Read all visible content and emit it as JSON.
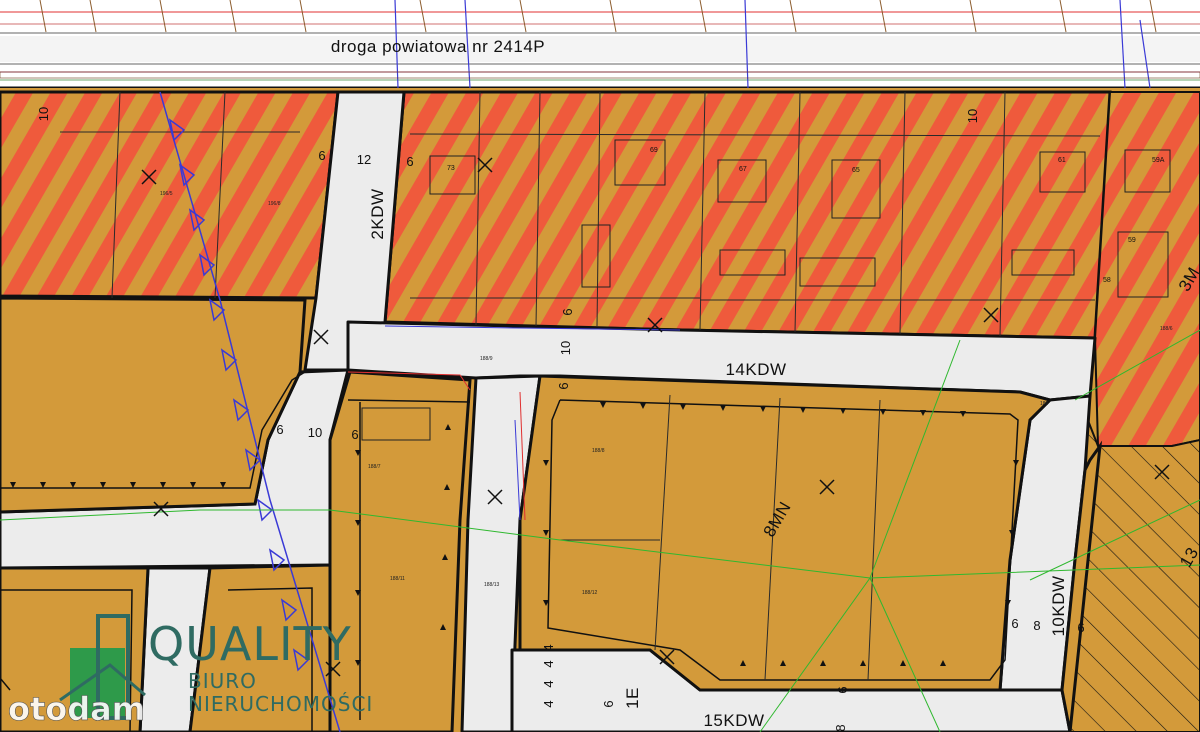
{
  "road": {
    "title": "droga powiatowa nr 2414P"
  },
  "zones": {
    "kdw_2": "2KDW",
    "kdw_14": "14KDW",
    "kdw_10": "10KDW",
    "kdw_15": "15KDW",
    "mn_8": "8MN",
    "edge_1e": "1E",
    "edge_3m": "3M",
    "edge_13": "13"
  },
  "dimensions": {
    "d10_left": "10",
    "d12": "12",
    "d6_a": "6",
    "d6_b": "6",
    "d10_top_right": "10",
    "d6_mid": "6",
    "d10_mid": "10",
    "d6_c": "6",
    "d6_left_road": "6",
    "d10_left_road": "10",
    "d6_left_road_b": "6",
    "d6_right_a": "6",
    "d8_right": "8",
    "d6_right_b": "6",
    "d4_a": "4",
    "d4_b": "4",
    "d4_c": "4",
    "d4_d": "4",
    "d6_bottom": "6",
    "d8_bottom": "8",
    "d6_small": "6"
  },
  "parcels": {
    "p73": "73",
    "p69": "69",
    "p67": "67",
    "p65": "65",
    "p61": "61",
    "p59a": "59A",
    "p59": "59",
    "p58": "58",
    "p188_6": "188/6",
    "p188_7": "188/7",
    "p188_8": "188/8",
    "p188_9": "188/9",
    "p188_11": "188/11",
    "p188_12": "188/12",
    "p188_13": "188/13",
    "p196_8": "196/8",
    "p196_5": "196/5",
    "p186": "186"
  },
  "logo": {
    "brand": "QUALITY",
    "line1": "BIURO",
    "line2": "NIERUCHOMOŚCI"
  },
  "watermark": {
    "text": "otodam"
  },
  "colors": {
    "zone_fill": "#d39a3a",
    "stripe_red": "#ef5a3c",
    "road_fill": "#ececec",
    "boundary": "#111111",
    "utility_blue": "#3a3ad6",
    "utility_green": "#2fb82f",
    "logo_teal": "#2f6b62"
  }
}
